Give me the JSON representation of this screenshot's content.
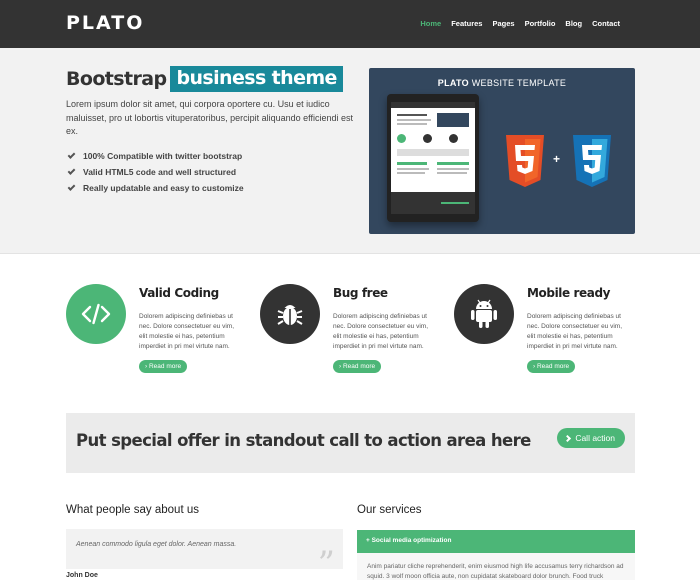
{
  "header": {
    "logo": "PLATO",
    "nav": [
      "Home",
      "Features",
      "Pages",
      "Portfolio",
      "Blog",
      "Contact"
    ],
    "active_nav": "Home"
  },
  "hero": {
    "title_main": "Bootstrap",
    "title_highlight": "business theme",
    "description": "Lorem ipsum dolor sit amet, qui corpora oportere cu. Usu et iudico maluisset, pro ut lobortis vituperatoribus, percipit aliquando efficiendi est ex.",
    "features": [
      "100% Compatible with twitter bootstrap",
      "Valid HTML5 code and well structured",
      "Really updatable and easy to customize"
    ],
    "promo_title_bold": "PLATO",
    "promo_title_rest": " WEBSITE TEMPLATE"
  },
  "features": [
    {
      "title": "Valid Coding",
      "icon": "code-icon",
      "text": "Dolorem adipiscing definiebas ut nec. Dolore consectetuer eu vim, elit molestie ei has, petentium imperdiet in pri mel virtute nam.",
      "button": "› Read more"
    },
    {
      "title": "Bug free",
      "icon": "bug-icon",
      "text": "Dolorem adipiscing definiebas ut nec. Dolore consectetuer eu vim, elit molestie ei has, petentium imperdiet in pri mel virtute nam.",
      "button": "› Read more"
    },
    {
      "title": "Mobile ready",
      "icon": "android-icon",
      "text": "Dolorem adipiscing definiebas ut nec. Dolore consectetuer eu vim, elit molestie ei has, petentium imperdiet in pri mel virtute nam.",
      "button": "› Read more"
    }
  ],
  "cta": {
    "text": "Put special offer in standout call to action area here",
    "button": "Call action"
  },
  "testimonials": {
    "title": "What people say about us",
    "quote": "Aenean commodo ligula eget dolor. Aenean massa.",
    "author": "John Doe"
  },
  "services": {
    "title": "Our services",
    "active_item": "+ Social media optimization",
    "text": "Anim pariatur cliche reprehenderit, enim eiusmod high life accusamus terry richardson ad squid. 3 wolf moon officia aute, non cupidatat skateboard dolor brunch. Food truck"
  },
  "colors": {
    "accent": "#4cb677",
    "highlight": "#19899a",
    "header_bg": "#333333",
    "promo_bg": "#33475e",
    "html5": "#e44d26",
    "css3": "#1572b6"
  }
}
